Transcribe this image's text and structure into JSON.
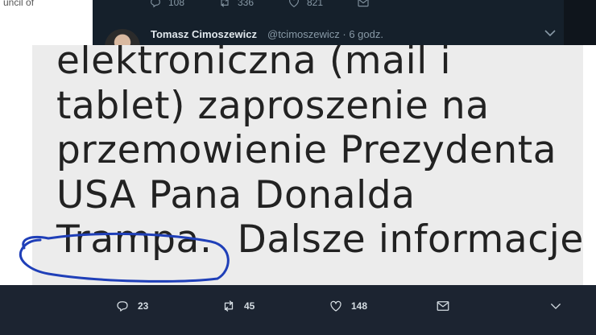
{
  "background_sidebar": {
    "text": "uncil of"
  },
  "previous_tweet_actions": {
    "replies": "108",
    "retweets": "336",
    "likes": "821"
  },
  "tweet": {
    "author_name": "Tomasz Cimoszewicz",
    "author_meta": "@tcimoszewicz · 6 godz.",
    "image_text_lines": [
      "elektroniczna (mail i",
      "tablet) zaproszenie na",
      "przemowienie Prezydenta",
      "USA Pana Donalda",
      "Trampa.  Dalsze informacje"
    ]
  },
  "actions": {
    "replies": "23",
    "retweets": "45",
    "likes": "148"
  },
  "colors": {
    "bar_bg": "#1c2431",
    "text_dark": "#222222",
    "annotation_stroke": "#1f3fb8"
  },
  "icons": [
    "reply-icon",
    "retweet-icon",
    "like-icon",
    "mail-icon",
    "chevron-down-icon"
  ]
}
